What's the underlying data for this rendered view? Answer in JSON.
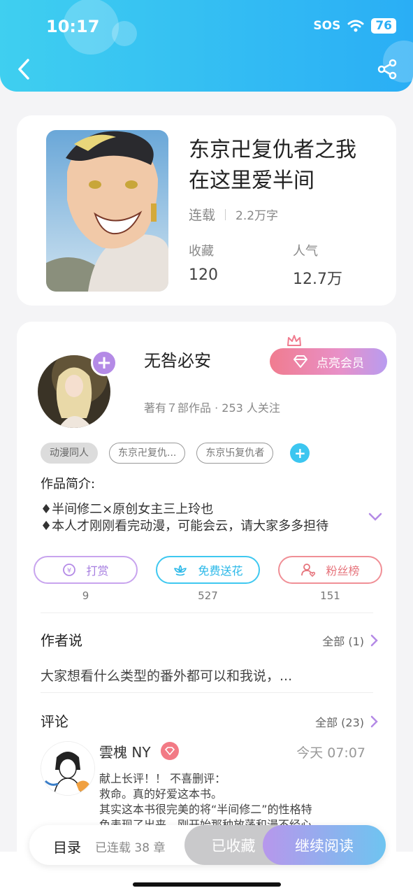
{
  "status": {
    "time": "10:17",
    "sos": "SOS",
    "battery": "76"
  },
  "nav": {
    "back_icon": "chevron-left-icon",
    "share_icon": "share-icon"
  },
  "book": {
    "title_line1": "东京卍复仇者之我",
    "title_line2": "在这里爱半间",
    "status": "连载",
    "words": "2.2万字",
    "stats": [
      {
        "label": "收藏",
        "value": "120"
      },
      {
        "label": "人气",
        "value": "12.7万"
      }
    ]
  },
  "author": {
    "name": "无咎必安",
    "info": "著有７部作品 · 253 人关注",
    "vip_label": "点亮会员"
  },
  "tags": [
    "动漫同人",
    "东京卍复仇...",
    "东京卐复仇者"
  ],
  "intro": {
    "title": "作品简介:",
    "lines": [
      "♦半间修二×原创女主三上玲也",
      "♦本人才刚刚看完动漫，可能会云，请大家多多担待"
    ]
  },
  "actions": [
    {
      "label": "打赏",
      "count": "9",
      "icon": "coin-icon"
    },
    {
      "label": "免费送花",
      "count": "527",
      "icon": "flower-icon"
    },
    {
      "label": "粉丝榜",
      "count": "151",
      "icon": "fans-icon"
    }
  ],
  "author_says": {
    "title": "作者说",
    "more": "全部 (1)",
    "text": "大家想看什么类型的番外都可以和我说，..."
  },
  "comments": {
    "title": "评论",
    "more": "全部 (23)",
    "first": {
      "name": "雲槐 NY",
      "time": "今天 07:07",
      "lines": [
        "献上长评！！ 不喜删评：",
        "救命。真的好爱这本书。",
        "其实这本书很完美的将“半间修二”的性格特",
        "色表现了出来，刚开始那种放荡和漫不经心"
      ]
    }
  },
  "bottom": {
    "toc": "目录",
    "chapters": "已连载 38 章",
    "collected": "已收藏",
    "continue": "继续阅读"
  },
  "colors": {
    "header": "#2aaef5",
    "accent_purple": "#b48ae6",
    "accent_pink": "#f07c8f"
  }
}
